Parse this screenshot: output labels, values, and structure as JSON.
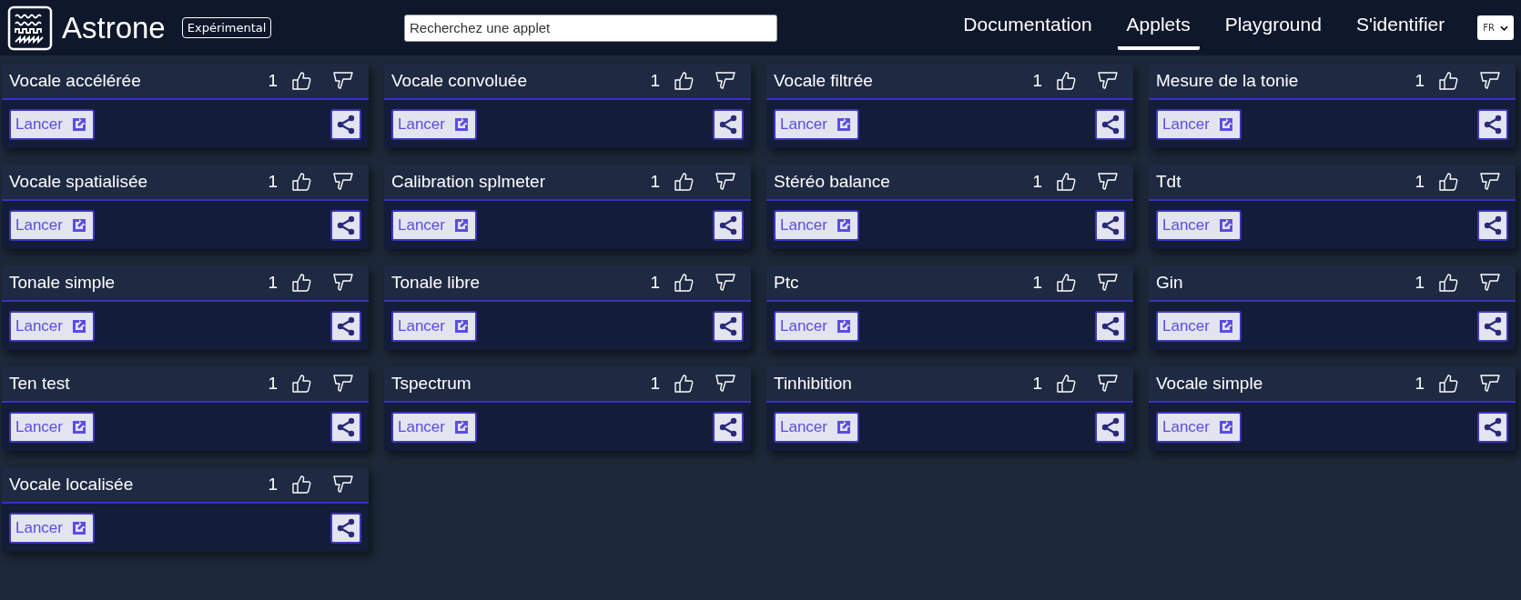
{
  "header": {
    "brand": "Astrone",
    "badge": "Expérimental",
    "search": {
      "placeholder": "Recherchez une applet"
    },
    "nav": [
      {
        "label": "Documentation",
        "selected": false
      },
      {
        "label": "Applets",
        "selected": true
      },
      {
        "label": "Playground",
        "selected": false
      },
      {
        "label": "S'identifier",
        "selected": false
      }
    ],
    "language": "FR"
  },
  "applets": [
    {
      "title": "Vocale accélérée",
      "likes": "1",
      "launch": "Lancer"
    },
    {
      "title": "Vocale convoluée",
      "likes": "1",
      "launch": "Lancer"
    },
    {
      "title": "Vocale filtrée",
      "likes": "1",
      "launch": "Lancer"
    },
    {
      "title": "Mesure de la tonie",
      "likes": "1",
      "launch": "Lancer"
    },
    {
      "title": "Vocale spatialisée",
      "likes": "1",
      "launch": "Lancer"
    },
    {
      "title": "Calibration splmeter",
      "likes": "1",
      "launch": "Lancer"
    },
    {
      "title": "Stéréo balance",
      "likes": "1",
      "launch": "Lancer"
    },
    {
      "title": "Tdt",
      "likes": "1",
      "launch": "Lancer"
    },
    {
      "title": "Tonale simple",
      "likes": "1",
      "launch": "Lancer"
    },
    {
      "title": "Tonale libre",
      "likes": "1",
      "launch": "Lancer"
    },
    {
      "title": "Ptc",
      "likes": "1",
      "launch": "Lancer"
    },
    {
      "title": "Gin",
      "likes": "1",
      "launch": "Lancer"
    },
    {
      "title": "Ten test",
      "likes": "1",
      "launch": "Lancer"
    },
    {
      "title": "Tspectrum",
      "likes": "1",
      "launch": "Lancer"
    },
    {
      "title": "Tinhibition",
      "likes": "1",
      "launch": "Lancer"
    },
    {
      "title": "Vocale simple",
      "likes": "1",
      "launch": "Lancer"
    },
    {
      "title": "Vocale localisée",
      "likes": "1",
      "launch": "Lancer"
    }
  ]
}
